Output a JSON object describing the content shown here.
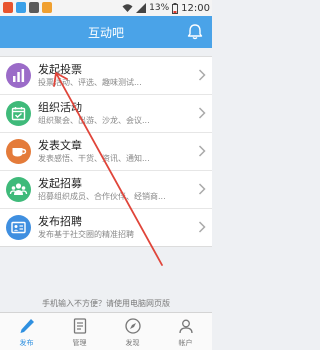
{
  "status_bar": {
    "battery": "13%",
    "time": "12:00"
  },
  "header": {
    "title": "互动吧"
  },
  "items": [
    {
      "title": "发起投票",
      "desc": "投票活动、评选、趣味测试..."
    },
    {
      "title": "组织活动",
      "desc": "组织聚会、出游、沙龙、会议..."
    },
    {
      "title": "发表文章",
      "desc": "发表感悟、干货、资讯、通知..."
    },
    {
      "title": "发起招募",
      "desc": "招募组织成员、合作伙伴、经销商..."
    },
    {
      "title": "发布招聘",
      "desc": "发布基于社交圈的精准招聘"
    }
  ],
  "tip": "手机输入不方便？请使用电脑网页版",
  "tabs": [
    {
      "label": "发布"
    },
    {
      "label": "管理"
    },
    {
      "label": "发现"
    },
    {
      "label": "帐户"
    }
  ],
  "colors": {
    "header": "#4aa3e8",
    "vote": "#9b6bc8",
    "activity": "#3fba7a",
    "article": "#e47b3a",
    "recruit": "#3fba7a",
    "job": "#3f8fe0",
    "annotation_arrow": "#e0453a"
  },
  "icons": [
    "bell-icon",
    "bar-chart-icon",
    "calendar-icon",
    "coffee-cup-icon",
    "people-icon",
    "id-card-icon",
    "pen-icon",
    "document-icon",
    "compass-icon",
    "user-icon"
  ]
}
